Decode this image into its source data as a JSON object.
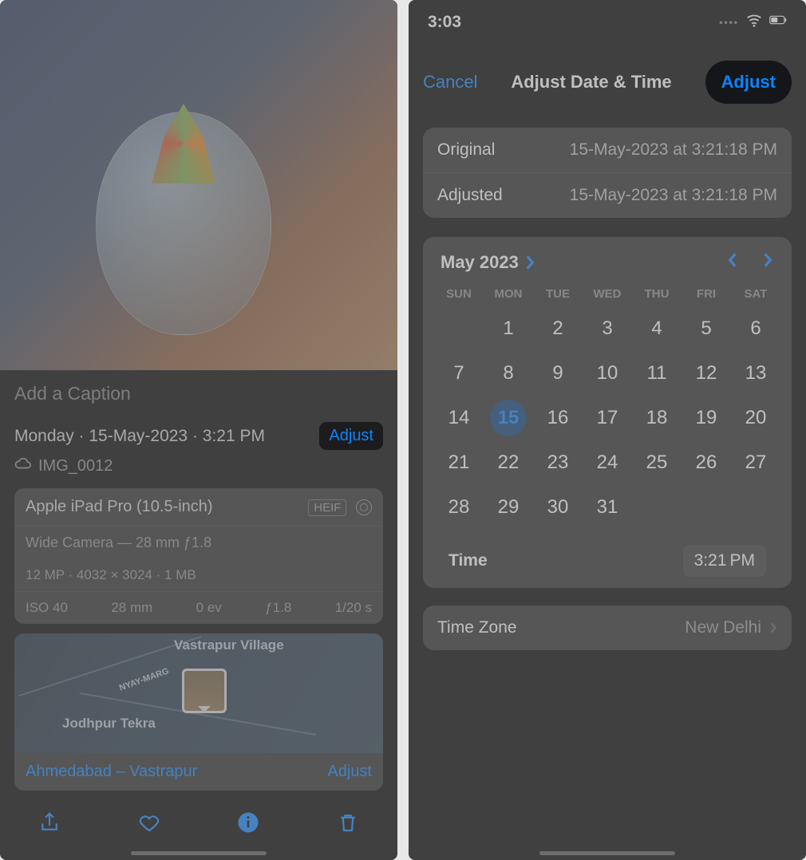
{
  "left": {
    "caption_placeholder": "Add a Caption",
    "date_line": "Monday · 15-May-2023 · 3:21 PM",
    "filename": "IMG_0012",
    "adjust_label": "Adjust",
    "device_name": "Apple iPad Pro (10.5-inch)",
    "format_badge": "HEIF",
    "camera_line": "Wide Camera — 28 mm ƒ1.8",
    "res_line": "12 MP · 4032 × 3024 · 1 MB",
    "specs": {
      "iso": "ISO 40",
      "focal": "28 mm",
      "ev": "0 ev",
      "aperture": "ƒ1.8",
      "shutter": "1/20 s"
    },
    "map": {
      "label1": "Vastrapur\nVillage",
      "label2": "Jodhpur\nTekra",
      "road": "NYAY-MARG",
      "location_text": "Ahmedabad – Vastrapur",
      "adjust_label": "Adjust"
    }
  },
  "right": {
    "status_time": "3:03",
    "nav_cancel": "Cancel",
    "nav_title": "Adjust Date & Time",
    "nav_adjust": "Adjust",
    "original_label": "Original",
    "original_value": "15-May-2023 at 3:21:18 PM",
    "adjusted_label": "Adjusted",
    "adjusted_value": "15-May-2023 at 3:21:18 PM",
    "month_label": "May 2023",
    "daynames": [
      "SUN",
      "MON",
      "TUE",
      "WED",
      "THU",
      "FRI",
      "SAT"
    ],
    "first_weekday": 1,
    "days_in_month": 31,
    "selected_day": 15,
    "time_label": "Time",
    "time_value": "3:21",
    "time_period": "PM",
    "tz_label": "Time Zone",
    "tz_value": "New Delhi"
  }
}
